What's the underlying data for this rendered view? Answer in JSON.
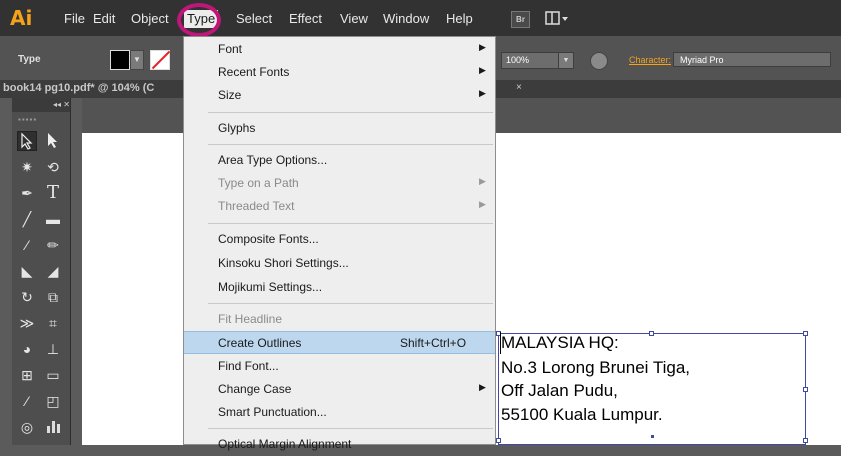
{
  "menubar": {
    "logo": "Ai",
    "items": [
      {
        "label": "File"
      },
      {
        "label": "Edit"
      },
      {
        "label": "Object"
      },
      {
        "label": "Type"
      },
      {
        "label": "Select"
      },
      {
        "label": "Effect"
      },
      {
        "label": "View"
      },
      {
        "label": "Window"
      },
      {
        "label": "Help"
      }
    ],
    "bridge_label": "Br",
    "workspace_icon": "arrange-documents-icon",
    "highlight_color": "#c0167a"
  },
  "control_bar": {
    "mode_label": "Type",
    "fill_color": "#000000",
    "stroke_none_color": "#e8232a",
    "opacity_value": "100%",
    "character_label": "Character:",
    "font_value": "Myriad Pro"
  },
  "document": {
    "tab_title": "book14 pg10.pdf* @ 104% (C",
    "close_label": "×"
  },
  "tools_panel": {
    "header_label": "◂◂ ✕",
    "grip": "▪▪▪▪▪"
  },
  "type_menu": {
    "items": [
      {
        "label": "Font",
        "submenu": true,
        "enabled": true
      },
      {
        "label": "Recent Fonts",
        "submenu": true,
        "enabled": true
      },
      {
        "label": "Size",
        "submenu": true,
        "enabled": true
      },
      {
        "label": "Glyphs",
        "enabled": true
      },
      {
        "label": "Area Type Options...",
        "enabled": true
      },
      {
        "label": "Type on a Path",
        "submenu": true,
        "enabled": false
      },
      {
        "label": "Threaded Text",
        "submenu": true,
        "enabled": false
      },
      {
        "label": "Composite Fonts...",
        "enabled": true
      },
      {
        "label": "Kinsoku Shori Settings...",
        "enabled": true
      },
      {
        "label": "Mojikumi Settings...",
        "enabled": true
      },
      {
        "label": "Fit Headline",
        "enabled": false
      },
      {
        "label": "Create Outlines",
        "shortcut": "Shift+Ctrl+O",
        "enabled": true,
        "highlighted": true
      },
      {
        "label": "Find Font...",
        "enabled": true
      },
      {
        "label": "Change Case",
        "submenu": true,
        "enabled": true
      },
      {
        "label": "Smart Punctuation...",
        "enabled": true
      },
      {
        "label": "Optical Margin Alignment",
        "enabled": true
      }
    ],
    "highlight_color": "#bcd7ee"
  },
  "artboard_text": {
    "lines": [
      "MALAYSIA HQ:",
      "No.3 Lorong Brunei Tiga,",
      "Off Jalan Pudu,",
      "55100 Kuala Lumpur."
    ],
    "selection_color": "#3f4aa0"
  }
}
